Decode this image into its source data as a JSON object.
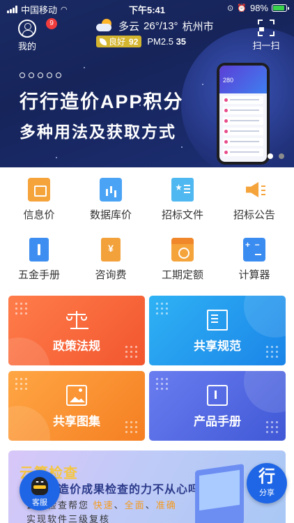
{
  "status_bar": {
    "carrier": "中国移动",
    "time": "下午5:41",
    "battery": "98%"
  },
  "header": {
    "mine_label": "我的",
    "badge_count": "9",
    "weather": {
      "condition": "多云",
      "temperature": "26°/13°",
      "city": "杭州市",
      "aqi_label": "良好",
      "aqi_value": "92",
      "pm_label": "PM2.5",
      "pm_value": "35"
    },
    "scan_label": "扫一扫"
  },
  "banner": {
    "title": "行行造价APP积分",
    "subtitle": "多种用法及获取方式",
    "phone_screen_number": "280",
    "slide_count": 2,
    "active_slide": 1
  },
  "grid": {
    "items": [
      {
        "label": "信息价",
        "icon": "info-price-icon"
      },
      {
        "label": "数据库价",
        "icon": "database-price-icon"
      },
      {
        "label": "招标文件",
        "icon": "tender-file-icon"
      },
      {
        "label": "招标公告",
        "icon": "announcement-icon"
      },
      {
        "label": "五金手册",
        "icon": "hardware-manual-icon"
      },
      {
        "label": "咨询费",
        "icon": "consulting-fee-icon"
      },
      {
        "label": "工期定额",
        "icon": "calendar-icon"
      },
      {
        "label": "计算器",
        "icon": "calculator-icon"
      }
    ]
  },
  "cards": [
    {
      "label": "政策法规",
      "icon": "scale-icon",
      "color": "#f2562f"
    },
    {
      "label": "共享规范",
      "icon": "document-icon",
      "color": "#1a84e8"
    },
    {
      "label": "共享图集",
      "icon": "image-icon",
      "color": "#f57f22"
    },
    {
      "label": "产品手册",
      "icon": "manual-icon",
      "color": "#4058d6"
    }
  ],
  "promo": {
    "title": "云算检查",
    "question": "过造价成果检查的力不从心吗?",
    "line3_prefix": "云算检查帮您",
    "line3_highlights": [
      "快速",
      "全面",
      "准确"
    ],
    "line4": "实现软件三级复核"
  },
  "fab": {
    "service_label": "客服",
    "share_char": "行",
    "share_label": "分享"
  }
}
